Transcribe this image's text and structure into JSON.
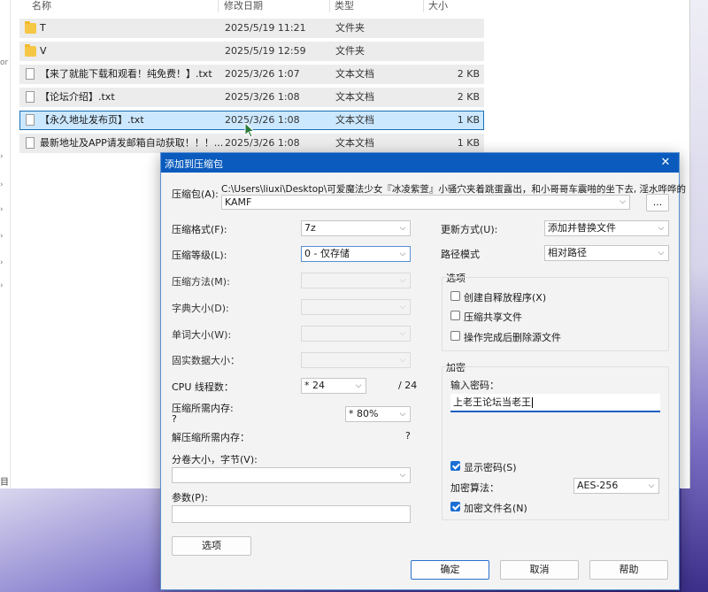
{
  "explorer": {
    "columns": {
      "name": "名称",
      "modified": "修改日期",
      "type": "类型",
      "size": "大小"
    },
    "files": [
      {
        "name": "T",
        "date": "2025/5/19 11:21",
        "type": "文件夹",
        "size": ""
      },
      {
        "name": "V",
        "date": "2025/5/19 12:59",
        "type": "文件夹",
        "size": ""
      },
      {
        "name": "【来了就能下载和观看！纯免费！】.txt",
        "date": "2025/3/26 1:07",
        "type": "文本文档",
        "size": "2 KB"
      },
      {
        "name": "【论坛介绍】.txt",
        "date": "2025/3/26 1:08",
        "type": "文本文档",
        "size": "2 KB"
      },
      {
        "name": "【永久地址发布页】.txt",
        "date": "2025/3/26 1:08",
        "type": "文本文档",
        "size": "1 KB"
      },
      {
        "name": "最新地址及APP请发邮箱自动获取！！！...",
        "date": "2025/3/26 1:08",
        "type": "文本文档",
        "size": "1 KB"
      }
    ],
    "status_fragment": "目",
    "left_fragment": "or"
  },
  "dialog": {
    "title": "添加到压缩包",
    "close": "✕",
    "archive_label": "压缩包(A):",
    "archive_path": "C:\\Users\\liuxi\\Desktop\\可爱魔法少女『冰凌紫萱』小骚穴夹着跳蛋露出，和小哥哥车震啪的坐下去, 淫水哗哗的",
    "archive_name": "KAMF",
    "browse_button": "...",
    "format_label": "压缩格式(F):",
    "format_value": "7z",
    "level_label": "压缩等级(L):",
    "level_value": "0 - 仅存储",
    "method_label": "压缩方法(M):",
    "dict_label": "字典大小(D):",
    "word_label": "单词大小(W):",
    "solid_label": "固实数据大小：",
    "cpu_label": "CPU 线程数：",
    "cpu_value": "* 24",
    "cpu_total": "/ 24",
    "mem_label": "压缩所需内存:",
    "mem_q": "?",
    "mem_value": "* 80%",
    "decomp_label": "解压缩所需内存：",
    "decomp_value": "?",
    "split_label": "分卷大小，字节(V):",
    "params_label": "参数(P):",
    "options_button": "选项",
    "update_label": "更新方式(U):",
    "update_value": "添加并替换文件",
    "path_mode_label": "路径模式",
    "path_mode_value": "相对路径",
    "options_group": "选项",
    "opt_sfx": "创建自释放程序(X)",
    "opt_shared": "压缩共享文件",
    "opt_delete": "操作完成后删除源文件",
    "encrypt_group": "加密",
    "pwd_label": "输入密码：",
    "pwd_value": "上老王论坛当老王",
    "show_pwd": "显示密码(S)",
    "enc_method_label": "加密算法：",
    "enc_method_value": "AES-256",
    "enc_names": "加密文件名(N)",
    "ok": "确定",
    "cancel": "取消",
    "help": "帮助"
  }
}
